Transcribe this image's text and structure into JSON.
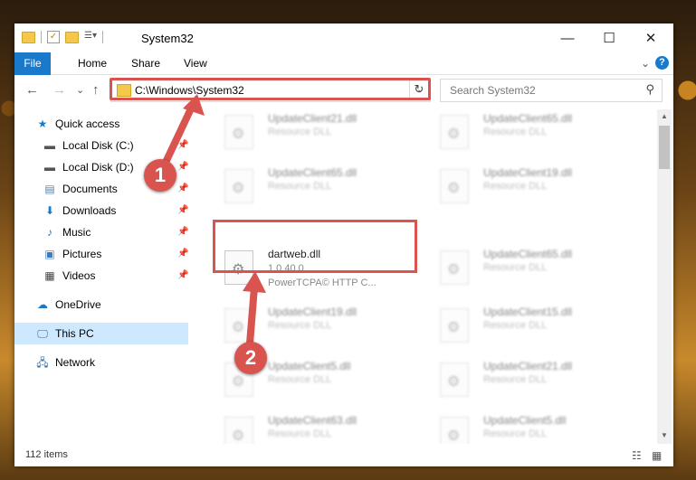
{
  "window": {
    "title": "System32",
    "minimize": "—",
    "maximize": "☐",
    "close": "✕"
  },
  "ribbon": {
    "tabs": [
      "File",
      "Home",
      "Share",
      "View"
    ],
    "expand": "⌄",
    "help": "?"
  },
  "nav": {
    "back": "←",
    "forward": "→",
    "recent": "⌄",
    "up": "↑",
    "address": "C:\\Windows\\System32",
    "refresh": "↻",
    "search_placeholder": "Search System32"
  },
  "sidebar": {
    "quick_access": "Quick access",
    "items": [
      {
        "label": "Local Disk (C:)",
        "icon": "drive-icon"
      },
      {
        "label": "Local Disk (D:)",
        "icon": "drive-icon"
      },
      {
        "label": "Documents",
        "icon": "documents-icon"
      },
      {
        "label": "Downloads",
        "icon": "downloads-icon"
      },
      {
        "label": "Music",
        "icon": "music-icon"
      },
      {
        "label": "Pictures",
        "icon": "pictures-icon"
      },
      {
        "label": "Videos",
        "icon": "videos-icon"
      }
    ],
    "onedrive": "OneDrive",
    "this_pc": "This PC",
    "network": "Network"
  },
  "files": {
    "highlighted": {
      "name": "dartweb.dll",
      "version": "1.0.40.0",
      "company": "PowerTCPA© HTTP C..."
    },
    "others": [
      {
        "name": "UpdateClient21.dll",
        "type": "Resource DLL"
      },
      {
        "name": "UpdateClient65.dll",
        "type": "Resource DLL"
      },
      {
        "name": "UpdateClient65.dll",
        "type": "Resource DLL"
      },
      {
        "name": "UpdateClient19.dll",
        "type": "Resource DLL"
      },
      {
        "name": "UpdateClient65.dll",
        "type": "Resource DLL"
      },
      {
        "name": "UpdateClient19.dll",
        "type": "Resource DLL"
      },
      {
        "name": "UpdateClient15.dll",
        "type": "Resource DLL"
      },
      {
        "name": "UpdateClient5.dll",
        "type": "Resource DLL"
      },
      {
        "name": "UpdateClient21.dll",
        "type": "Resource DLL"
      },
      {
        "name": "UpdateClient63.dll",
        "type": "Resource DLL"
      },
      {
        "name": "UpdateClient5.dll",
        "type": "Resource DLL"
      }
    ]
  },
  "status": {
    "items": "112 items"
  },
  "annotations": {
    "step1": "1",
    "step2": "2",
    "color": "#d9534f"
  }
}
